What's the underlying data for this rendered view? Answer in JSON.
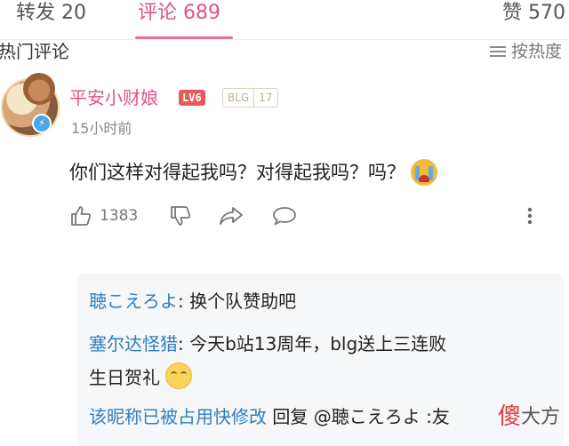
{
  "tabs": [
    {
      "label": "转发 20"
    },
    {
      "label": "评论 689"
    },
    {
      "label": "赞 570"
    }
  ],
  "section": {
    "hot_label": "热门评论",
    "sort_label": "按热度"
  },
  "comment": {
    "username": "平安小财娘",
    "level": "LV6",
    "fan_badge_name": "BLG",
    "fan_badge_level": "17",
    "timestamp": "15小时前",
    "text": "你们这样对得起我吗？对得起我吗？吗？",
    "likes": "1383"
  },
  "replies": [
    {
      "author": "聴こえろよ",
      "text": ": 换个队赞助吧"
    },
    {
      "author": "塞尔达怪猎",
      "text": ": 今天b站13周年，blg送上三连败",
      "text2": "生日贺礼"
    },
    {
      "author": "该昵称已被占用快修改",
      "text": " 回复 @聴こえろよ :友"
    }
  ],
  "watermark": {
    "part1": "傻",
    "part2": "大方"
  },
  "colors": {
    "accent": "#e0528f",
    "link": "#2f7fbf"
  }
}
